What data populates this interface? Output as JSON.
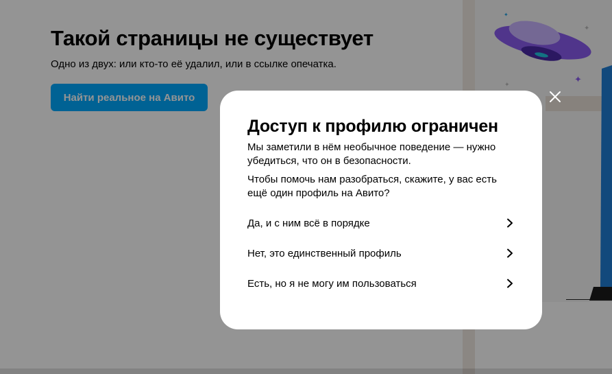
{
  "error_page": {
    "title": "Такой страницы не существует",
    "subtitle": "Одно из двух: или кто-то её удалил, или в ссылке опечатка.",
    "button_label": "Найти реальное на Авито"
  },
  "modal": {
    "title": "Доступ к профилю ограничен",
    "paragraph1": "Мы заметили в нём необычное поведение — нужно убедиться, что он в безопасности.",
    "paragraph2": "Чтобы помочь нам разобраться, скажите, у вас есть ещё один профиль на Авито?",
    "options": [
      {
        "label": "Да, и с ним всё в порядке",
        "icon": "chevron-right-icon"
      },
      {
        "label": "Нет, это единственный профиль",
        "icon": "chevron-right-icon"
      },
      {
        "label": "Есть, но я не могу им пользоваться",
        "icon": "chevron-right-icon"
      }
    ],
    "close_icon": "close-icon"
  },
  "colors": {
    "accent": "#00aaff",
    "ufo_purple": "#8a5cf0",
    "jeans_blue": "#1f7fd6"
  }
}
